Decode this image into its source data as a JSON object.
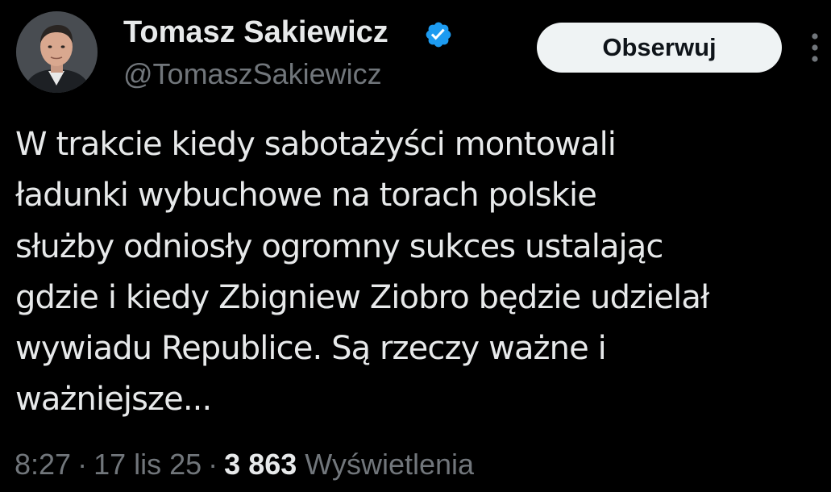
{
  "author": {
    "display_name": "Tomasz Sakiewicz",
    "handle": "@TomaszSakiewicz",
    "verified": true,
    "avatar_icon": "person-portrait-avatar",
    "verified_icon": "verified-badge-icon"
  },
  "follow_button": {
    "label": "Obserwuj"
  },
  "more_button": {
    "icon": "more-vertical-icon"
  },
  "tweet": {
    "lines": [
      "W trakcie kiedy sabotażyści montowali",
      "ładunki wybuchowe na torach polskie",
      "służby odniosły ogromny sukces ustalając",
      "gdzie i kiedy Zbigniew Ziobro będzie udzielał",
      "wywiadu Republice. Są rzeczy ważne i",
      "ważniejsze..."
    ]
  },
  "meta": {
    "time": "8:27",
    "separator": "·",
    "date": "17 lis 25",
    "views_count": "3 863",
    "views_label": "Wyświetlenia"
  },
  "colors": {
    "background": "#000000",
    "text_primary": "#e7e9ea",
    "text_secondary": "#71767b",
    "verified_blue": "#1d9bf0",
    "button_bg": "#eff3f4",
    "button_text": "#0f1419"
  }
}
